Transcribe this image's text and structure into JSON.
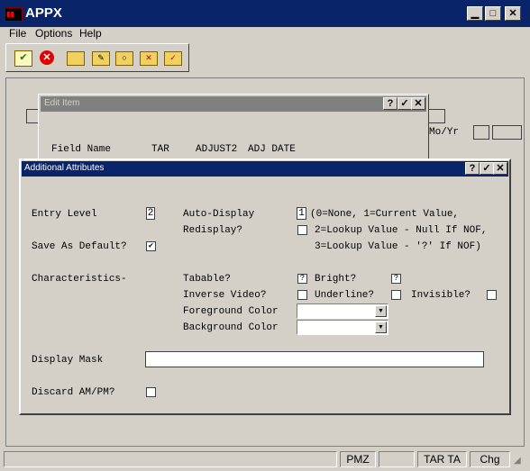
{
  "window": {
    "title": "APPX"
  },
  "menu": {
    "file": "File",
    "options": "Options",
    "help": "Help"
  },
  "edit_item": {
    "title": "Edit Item",
    "header": {
      "field_name": "Field Name",
      "tar": "TAR",
      "adjust2": "ADJUST2",
      "adj_date": "ADJ DATE"
    },
    "behind_label": "Mo/Yr"
  },
  "dialog": {
    "title": "Additional Attributes",
    "entry_level": {
      "label": "Entry Level",
      "value": "2"
    },
    "auto_display": {
      "label": "Auto-Display",
      "value": "1",
      "hint1": "(0=None, 1=Current Value,"
    },
    "redisplay": {
      "label": "Redisplay?",
      "hint2": "2=Lookup Value - Null If NOF,",
      "hint3": "3=Lookup Value - '?' If NOF)"
    },
    "save_default": {
      "label": "Save As Default?",
      "checked": "✔"
    },
    "characteristics": {
      "label": "Characteristics-"
    },
    "tabable": {
      "label": "Tabable?",
      "value": "?"
    },
    "bright": {
      "label": "Bright?",
      "value": "?"
    },
    "inverse": {
      "label": "Inverse Video?"
    },
    "underline": {
      "label": "Underline?"
    },
    "invisible": {
      "label": "Invisible?"
    },
    "fg_color": {
      "label": "Foreground Color",
      "value": ""
    },
    "bg_color": {
      "label": "Background Color",
      "value": ""
    },
    "display_mask": {
      "label": "Display Mask",
      "value": ""
    },
    "discard": {
      "label": "Discard AM/PM?"
    }
  },
  "status": {
    "pmz": "PMZ",
    "tar": "TAR TA",
    "chg": "Chg"
  }
}
